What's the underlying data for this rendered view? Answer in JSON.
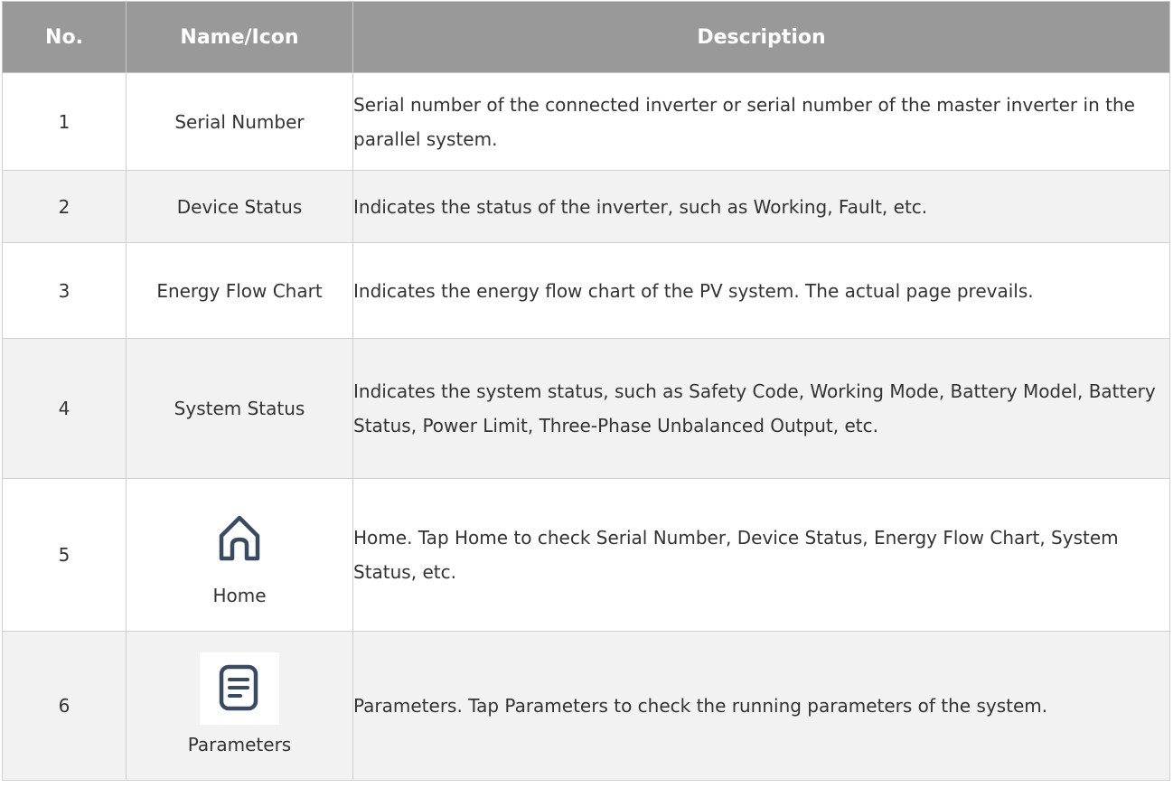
{
  "table": {
    "headers": {
      "no": "No.",
      "name": "Name/Icon",
      "description": "Description"
    },
    "rows": [
      {
        "no": "1",
        "name": "Serial Number",
        "description": "Serial number of the connected inverter or serial number of the master inverter in the parallel system."
      },
      {
        "no": "2",
        "name": "Device Status",
        "description": "Indicates the status of the inverter, such as Working, Fault, etc."
      },
      {
        "no": "3",
        "name": "Energy Flow Chart",
        "description": "Indicates the energy flow chart of the PV system. The actual page prevails."
      },
      {
        "no": "4",
        "name": "System Status",
        "description": "Indicates the system status, such as Safety Code, Working Mode, Battery Model, Battery Status, Power Limit, Three-Phase Unbalanced Output, etc."
      },
      {
        "no": "5",
        "name": "Home",
        "icon": "home-icon",
        "description": "Home. Tap Home to check Serial Number, Device Status, Energy Flow Chart, System Status, etc."
      },
      {
        "no": "6",
        "name": "Parameters",
        "icon": "parameters-icon",
        "description": "Parameters. Tap Parameters to check the running parameters of the system."
      }
    ]
  },
  "colors": {
    "header_bg": "#999999",
    "header_text": "#ffffff",
    "alt_row_bg": "#f2f2f2",
    "icon_stroke": "#3a4a60"
  }
}
